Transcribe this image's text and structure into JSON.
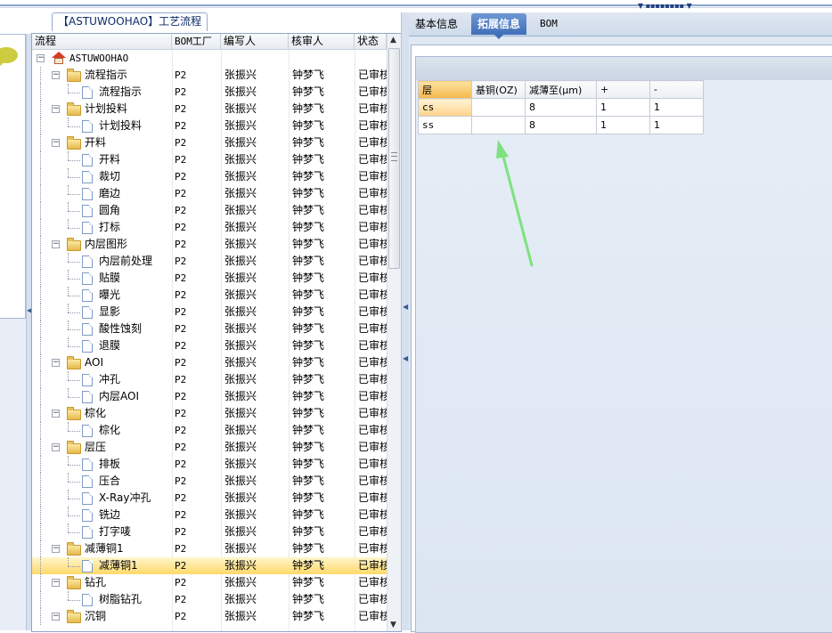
{
  "middle_panel": {
    "title": "【ASTUWOOHAO】工艺流程"
  },
  "tree": {
    "columns": [
      "流程",
      "BOM工厂",
      "编写人",
      "核审人",
      "状态"
    ],
    "root": "ASTUWOOHAO",
    "rows": [
      {
        "label": "流程指示",
        "level": 1,
        "type": "folder",
        "bom": "P2",
        "writer": "张振兴",
        "reviewer": "钟梦飞",
        "status": "已审核"
      },
      {
        "label": "流程指示",
        "level": 2,
        "type": "doc",
        "bom": "P2",
        "writer": "张振兴",
        "reviewer": "钟梦飞",
        "status": "已审核"
      },
      {
        "label": "计划投料",
        "level": 1,
        "type": "folder",
        "bom": "P2",
        "writer": "张振兴",
        "reviewer": "钟梦飞",
        "status": "已审核"
      },
      {
        "label": "计划投料",
        "level": 2,
        "type": "doc",
        "bom": "P2",
        "writer": "张振兴",
        "reviewer": "钟梦飞",
        "status": "已审核"
      },
      {
        "label": "开料",
        "level": 1,
        "type": "folder",
        "bom": "P2",
        "writer": "张振兴",
        "reviewer": "钟梦飞",
        "status": "已审核"
      },
      {
        "label": "开料",
        "level": 2,
        "type": "doc",
        "bom": "P2",
        "writer": "张振兴",
        "reviewer": "钟梦飞",
        "status": "已审核"
      },
      {
        "label": "裁切",
        "level": 2,
        "type": "doc",
        "bom": "P2",
        "writer": "张振兴",
        "reviewer": "钟梦飞",
        "status": "已审核"
      },
      {
        "label": "磨边",
        "level": 2,
        "type": "doc",
        "bom": "P2",
        "writer": "张振兴",
        "reviewer": "钟梦飞",
        "status": "已审核"
      },
      {
        "label": "圆角",
        "level": 2,
        "type": "doc",
        "bom": "P2",
        "writer": "张振兴",
        "reviewer": "钟梦飞",
        "status": "已审核"
      },
      {
        "label": "打标",
        "level": 2,
        "type": "doc",
        "bom": "P2",
        "writer": "张振兴",
        "reviewer": "钟梦飞",
        "status": "已审核"
      },
      {
        "label": "内层图形",
        "level": 1,
        "type": "folder",
        "bom": "P2",
        "writer": "张振兴",
        "reviewer": "钟梦飞",
        "status": "已审核"
      },
      {
        "label": "内层前处理",
        "level": 2,
        "type": "doc",
        "bom": "P2",
        "writer": "张振兴",
        "reviewer": "钟梦飞",
        "status": "已审核"
      },
      {
        "label": "贴膜",
        "level": 2,
        "type": "doc",
        "bom": "P2",
        "writer": "张振兴",
        "reviewer": "钟梦飞",
        "status": "已审核"
      },
      {
        "label": "曝光",
        "level": 2,
        "type": "doc",
        "bom": "P2",
        "writer": "张振兴",
        "reviewer": "钟梦飞",
        "status": "已审核"
      },
      {
        "label": "显影",
        "level": 2,
        "type": "doc",
        "bom": "P2",
        "writer": "张振兴",
        "reviewer": "钟梦飞",
        "status": "已审核"
      },
      {
        "label": "酸性蚀刻",
        "level": 2,
        "type": "doc",
        "bom": "P2",
        "writer": "张振兴",
        "reviewer": "钟梦飞",
        "status": "已审核"
      },
      {
        "label": "退膜",
        "level": 2,
        "type": "doc",
        "bom": "P2",
        "writer": "张振兴",
        "reviewer": "钟梦飞",
        "status": "已审核"
      },
      {
        "label": "AOI",
        "level": 1,
        "type": "folder",
        "bom": "P2",
        "writer": "张振兴",
        "reviewer": "钟梦飞",
        "status": "已审核"
      },
      {
        "label": "冲孔",
        "level": 2,
        "type": "doc",
        "bom": "P2",
        "writer": "张振兴",
        "reviewer": "钟梦飞",
        "status": "已审核"
      },
      {
        "label": "内层AOI",
        "level": 2,
        "type": "doc",
        "bom": "P2",
        "writer": "张振兴",
        "reviewer": "钟梦飞",
        "status": "已审核"
      },
      {
        "label": "棕化",
        "level": 1,
        "type": "folder",
        "bom": "P2",
        "writer": "张振兴",
        "reviewer": "钟梦飞",
        "status": "已审核"
      },
      {
        "label": "棕化",
        "level": 2,
        "type": "doc",
        "bom": "P2",
        "writer": "张振兴",
        "reviewer": "钟梦飞",
        "status": "已审核"
      },
      {
        "label": "层压",
        "level": 1,
        "type": "folder",
        "bom": "P2",
        "writer": "张振兴",
        "reviewer": "钟梦飞",
        "status": "已审核"
      },
      {
        "label": "排板",
        "level": 2,
        "type": "doc",
        "bom": "P2",
        "writer": "张振兴",
        "reviewer": "钟梦飞",
        "status": "已审核"
      },
      {
        "label": "压合",
        "level": 2,
        "type": "doc",
        "bom": "P2",
        "writer": "张振兴",
        "reviewer": "钟梦飞",
        "status": "已审核"
      },
      {
        "label": "X-Ray冲孔",
        "level": 2,
        "type": "doc",
        "bom": "P2",
        "writer": "张振兴",
        "reviewer": "钟梦飞",
        "status": "已审核"
      },
      {
        "label": "铣边",
        "level": 2,
        "type": "doc",
        "bom": "P2",
        "writer": "张振兴",
        "reviewer": "钟梦飞",
        "status": "已审核"
      },
      {
        "label": "打字唛",
        "level": 2,
        "type": "doc",
        "bom": "P2",
        "writer": "张振兴",
        "reviewer": "钟梦飞",
        "status": "已审核"
      },
      {
        "label": "减薄铜1",
        "level": 1,
        "type": "folder",
        "bom": "P2",
        "writer": "张振兴",
        "reviewer": "钟梦飞",
        "status": "已审核"
      },
      {
        "label": "减薄铜1",
        "level": 2,
        "type": "doc",
        "selected": true,
        "bom": "P2",
        "writer": "张振兴",
        "reviewer": "钟梦飞",
        "status": "已审核"
      },
      {
        "label": "钻孔",
        "level": 1,
        "type": "folder",
        "bom": "P2",
        "writer": "张振兴",
        "reviewer": "钟梦飞",
        "status": "已审核"
      },
      {
        "label": "树脂钻孔",
        "level": 2,
        "type": "doc",
        "bom": "P2",
        "writer": "张振兴",
        "reviewer": "钟梦飞",
        "status": "已审核"
      },
      {
        "label": "沉铜",
        "level": 1,
        "type": "folder",
        "bom": "P2",
        "writer": "张振兴",
        "reviewer": "钟梦飞",
        "status": "已审核"
      }
    ]
  },
  "right_panel": {
    "tabs": [
      {
        "label": "基本信息",
        "active": false
      },
      {
        "label": "拓展信息",
        "active": true
      },
      {
        "label": "BOM",
        "active": false
      }
    ],
    "grid": {
      "headers": [
        "层",
        "基铜(OZ)",
        "减薄至(μm)",
        "+",
        "-"
      ],
      "rows": [
        {
          "layer": "cs",
          "base_cu": "",
          "thin_to": "8",
          "plus": "1",
          "minus": "1"
        },
        {
          "layer": "ss",
          "base_cu": "",
          "thin_to": "8",
          "plus": "1",
          "minus": "1"
        }
      ]
    }
  },
  "colors": {
    "accent": "#3f6fb8",
    "selection": "#ffd96a",
    "annotation_arrow": "#7de27d"
  }
}
